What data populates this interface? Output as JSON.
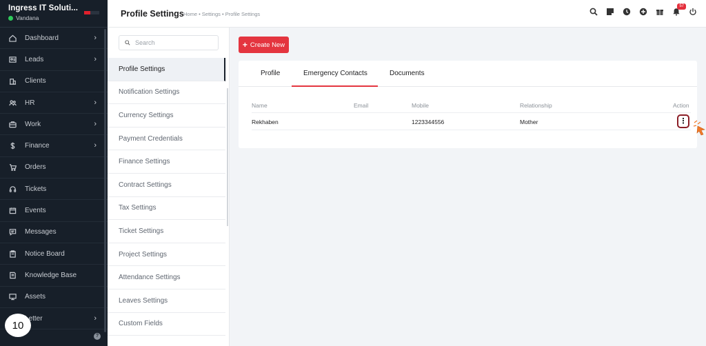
{
  "sidebar": {
    "company": "Ingress IT Soluti...",
    "user": "Vandana",
    "items": [
      {
        "label": "Dashboard",
        "icon": "home-icon",
        "chevron": true
      },
      {
        "label": "Leads",
        "icon": "id-card-icon",
        "chevron": true
      },
      {
        "label": "Clients",
        "icon": "building-icon",
        "chevron": false
      },
      {
        "label": "HR",
        "icon": "people-icon",
        "chevron": true
      },
      {
        "label": "Work",
        "icon": "briefcase-icon",
        "chevron": true
      },
      {
        "label": "Finance",
        "icon": "dollar-icon",
        "chevron": true
      },
      {
        "label": "Orders",
        "icon": "cart-icon",
        "chevron": false
      },
      {
        "label": "Tickets",
        "icon": "headset-icon",
        "chevron": false
      },
      {
        "label": "Events",
        "icon": "calendar-icon",
        "chevron": false
      },
      {
        "label": "Messages",
        "icon": "chat-icon",
        "chevron": false
      },
      {
        "label": "Notice Board",
        "icon": "clipboard-icon",
        "chevron": false
      },
      {
        "label": "Knowledge Base",
        "icon": "book-icon",
        "chevron": false
      },
      {
        "label": "Assets",
        "icon": "monitor-icon",
        "chevron": false
      },
      {
        "label": "Letter",
        "icon": "letter-icon",
        "chevron": true
      }
    ],
    "step_badge": "10"
  },
  "header": {
    "title": "Profile Settings",
    "breadcrumb": "Home • Settings • Profile Settings",
    "notification_count": "57"
  },
  "settings_menu": {
    "search_placeholder": "Search",
    "items": [
      "Profile Settings",
      "Notification Settings",
      "Currency Settings",
      "Payment Credentials",
      "Finance Settings",
      "Contract Settings",
      "Tax Settings",
      "Ticket Settings",
      "Project Settings",
      "Attendance Settings",
      "Leaves Settings",
      "Custom Fields"
    ],
    "active_index": 0
  },
  "main": {
    "create_label": "Create New",
    "tabs": [
      "Profile",
      "Emergency Contacts",
      "Documents"
    ],
    "active_tab": 1,
    "table": {
      "headers": [
        "Name",
        "Email",
        "Mobile",
        "Relationship",
        "Action"
      ],
      "rows": [
        {
          "name": "Rekhaben",
          "email": "",
          "mobile": "1223344556",
          "relationship": "Mother",
          "action": "⋮"
        }
      ]
    }
  },
  "colors": {
    "accent": "#e4353f",
    "sidebar_bg": "#171f29",
    "online": "#2fc95b"
  }
}
